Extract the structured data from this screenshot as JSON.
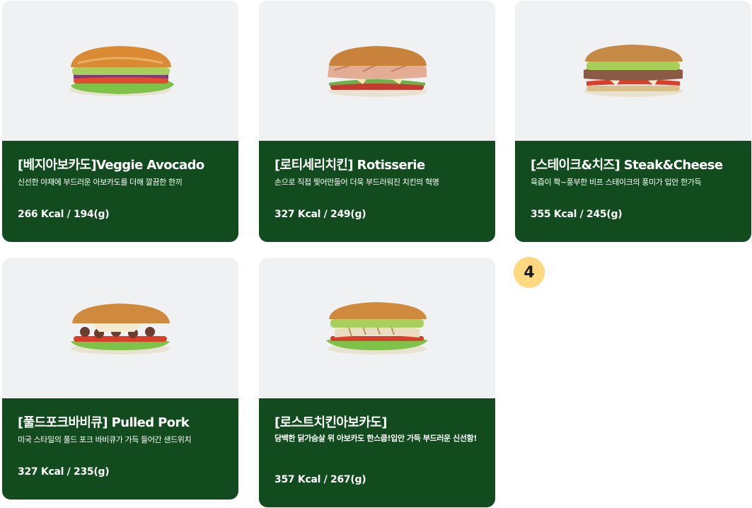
{
  "menu": {
    "items": [
      {
        "title": "[베지아보카도]Veggie Avocado",
        "description": "신선한 야채에 부드러운 아보카도를 더해 깔끔한 한끼",
        "nutrition": "266 Kcal / 194(g)",
        "image": "veggie-avocado-sandwich"
      },
      {
        "title": "[로티세리치킨] Rotisserie",
        "description": "손으로 직접 찢어만들어 더욱 부드러워진 치킨의 혁명",
        "nutrition": "327 Kcal / 249(g)",
        "image": "rotisserie-chicken-sandwich"
      },
      {
        "title": "[스테이크&치즈] Steak&Cheese",
        "description": "육즙이 쫙~풍부한 비프 스테이크의 풍미가 입안 한가득",
        "nutrition": "355 Kcal / 245(g)",
        "image": "steak-cheese-sandwich"
      },
      {
        "title": "[풀드포크바비큐] Pulled Pork",
        "description": "미국 스타일의 풀드 포크 바비큐가 가득 들어간 샌드위치",
        "nutrition": "327 Kcal / 235(g)",
        "image": "pulled-pork-sandwich"
      },
      {
        "title": "[로스트치킨아보카도]",
        "description": "담백한 닭가슴살 위 아보카도 한스쿱!입안 가득 부드러운 신선함!",
        "nutrition": "357 Kcal / 267(g)",
        "image": "roast-chicken-avocado-sandwich"
      }
    ]
  },
  "annotation": {
    "badge": "4"
  },
  "colors": {
    "card_info_bg": "#114b1e",
    "card_image_bg": "#f0f1f3",
    "badge_bg": "#ffd980"
  }
}
